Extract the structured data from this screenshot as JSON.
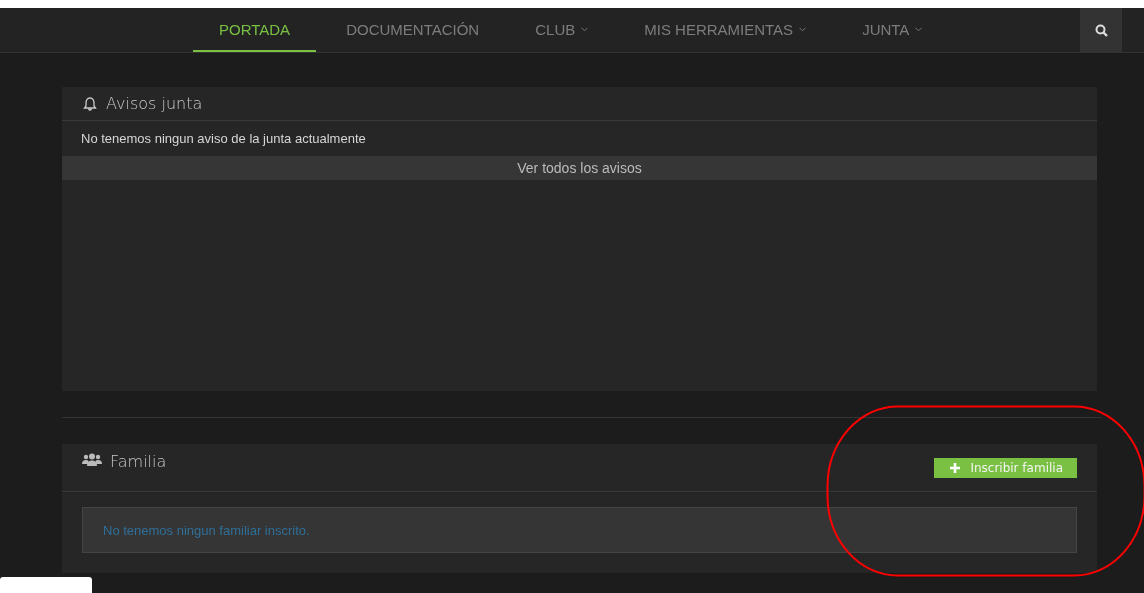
{
  "nav": {
    "items": [
      {
        "label": "PORTADA",
        "selected": true,
        "dropdown": false
      },
      {
        "label": "DOCUMENTACIÓN",
        "selected": false,
        "dropdown": false
      },
      {
        "label": "CLUB",
        "selected": false,
        "dropdown": true
      },
      {
        "label": "MIS HERRAMIENTAS",
        "selected": false,
        "dropdown": true
      },
      {
        "label": "JUNTA",
        "selected": false,
        "dropdown": true
      }
    ]
  },
  "notices_panel": {
    "title": "Avisos junta",
    "message": "No tenemos ningun aviso de la junta actualmente",
    "footer_link": "Ver todos los avisos"
  },
  "family_panel": {
    "title": "Familia",
    "button": "Inscribir familia",
    "message": "No tenemos ningun familiar inscrito."
  }
}
